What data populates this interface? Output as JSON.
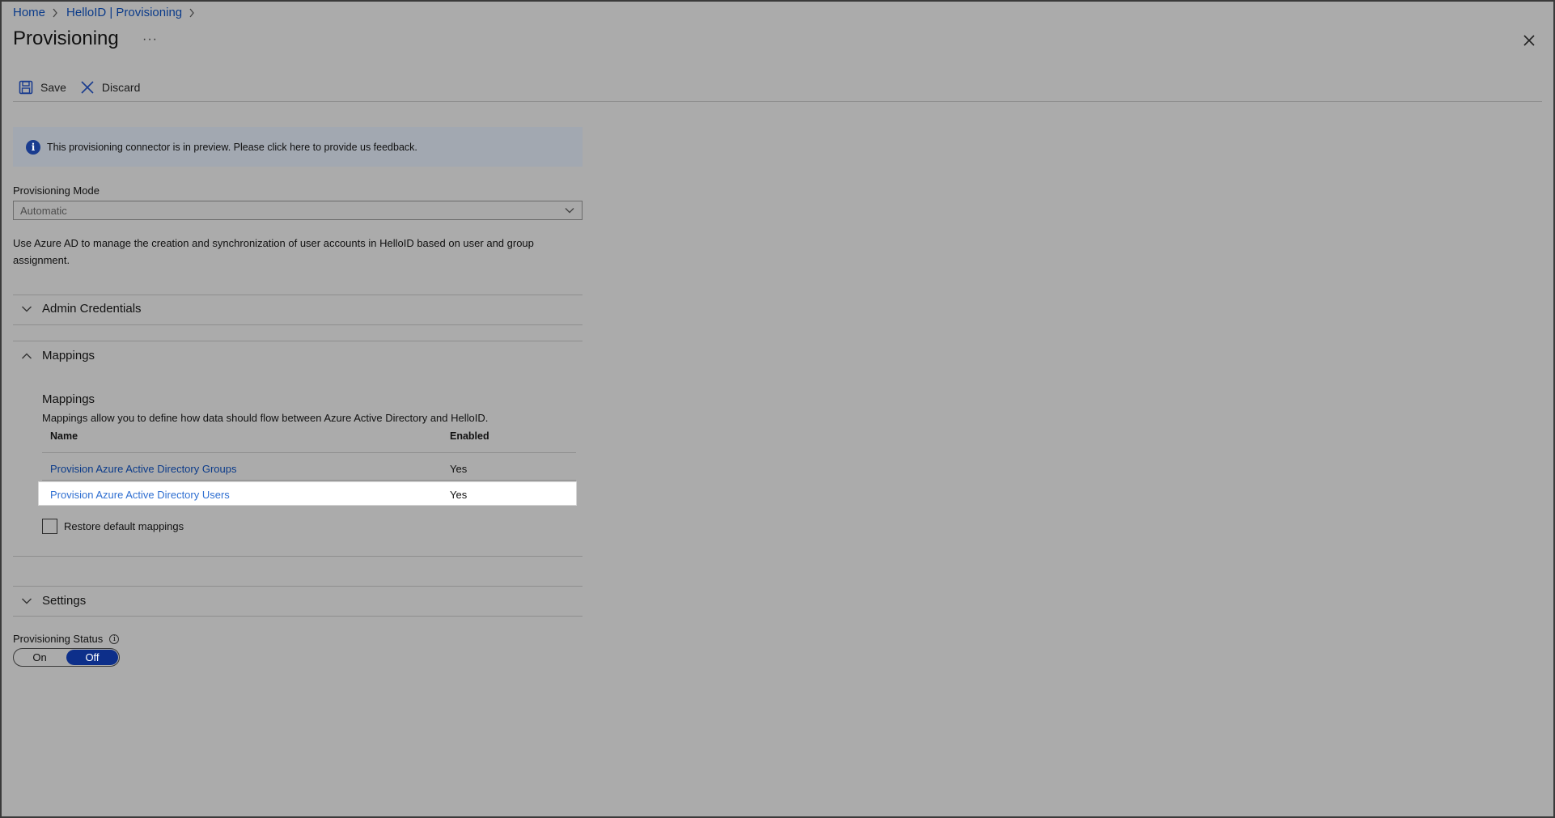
{
  "breadcrumb": {
    "home": "Home",
    "app": "HelloID | Provisioning"
  },
  "page": {
    "title": "Provisioning",
    "more": "···"
  },
  "toolbar": {
    "save_label": "Save",
    "discard_label": "Discard"
  },
  "banner": {
    "text": "This provisioning connector is in preview. Please click here to provide us feedback."
  },
  "provisioning_mode": {
    "label": "Provisioning Mode",
    "value": "Automatic",
    "description": "Use Azure AD to manage the creation and synchronization of user accounts in HelloID based on user and group assignment."
  },
  "sections": {
    "admin_credentials": "Admin Credentials",
    "mappings": "Mappings",
    "settings": "Settings"
  },
  "mappings": {
    "title": "Mappings",
    "description": "Mappings allow you to define how data should flow between Azure Active Directory and HelloID.",
    "columns": {
      "name": "Name",
      "enabled": "Enabled"
    },
    "rows": [
      {
        "name": "Provision Azure Active Directory Groups",
        "enabled": "Yes"
      },
      {
        "name": "Provision Azure Active Directory Users",
        "enabled": "Yes"
      }
    ],
    "restore_label": "Restore default mappings"
  },
  "status": {
    "label": "Provisioning Status",
    "on": "On",
    "off": "Off",
    "selected": "Off"
  },
  "colors": {
    "accent": "#0d2f8a",
    "link": "#0b3b8a",
    "background": "#ababab"
  }
}
